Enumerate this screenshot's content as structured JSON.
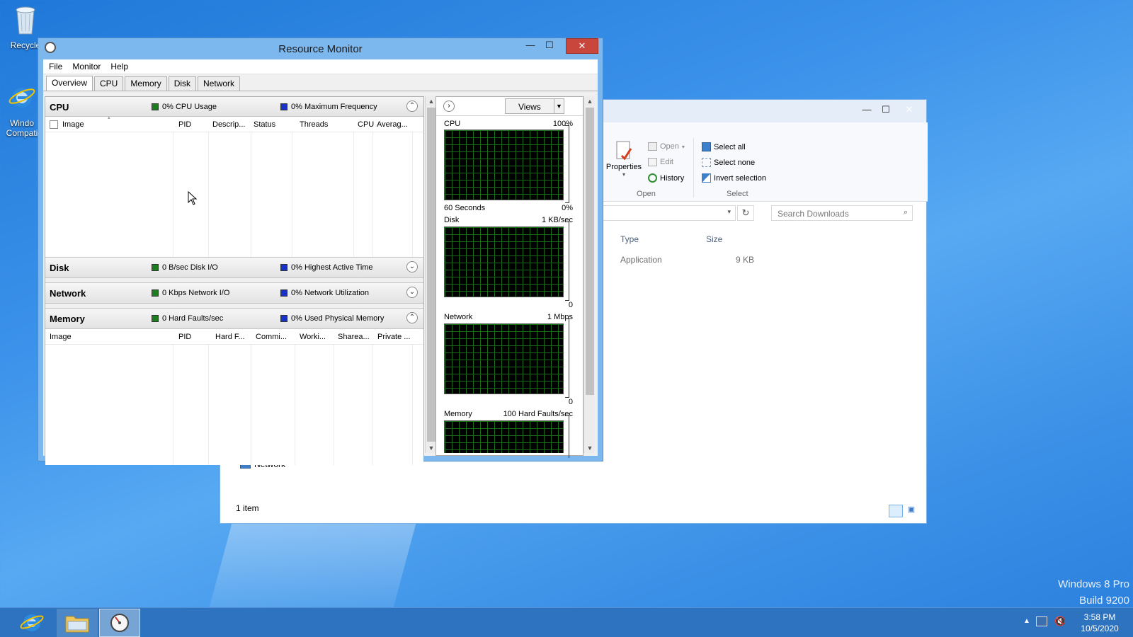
{
  "desktop": {
    "recycle_label": "Recycle",
    "ie_label_line1": "Windo",
    "ie_label_line2": "Compati",
    "watermark_line1": "Windows 8 Pro",
    "watermark_line2": "Build 9200"
  },
  "explorer": {
    "ribbon": {
      "properties": "Properties",
      "open": "Open",
      "edit": "Edit",
      "history": "History",
      "open_group": "Open",
      "select_all": "Select all",
      "select_none": "Select none",
      "invert_selection": "Invert selection",
      "select_group": "Select"
    },
    "search_placeholder": "Search Downloads",
    "columns": {
      "type": "Type",
      "size": "Size"
    },
    "row": {
      "type": "Application",
      "size": "9 KB"
    },
    "nav_network": "Network",
    "status": "1 item"
  },
  "resmon": {
    "title": "Resource Monitor",
    "menu": [
      "File",
      "Monitor",
      "Help"
    ],
    "tabs": [
      "Overview",
      "CPU",
      "Memory",
      "Disk",
      "Network"
    ],
    "active_tab": "Overview",
    "cpu": {
      "name": "CPU",
      "metric1": "0% CPU Usage",
      "metric2": "0% Maximum Frequency",
      "columns": [
        "Image",
        "PID",
        "Descrip...",
        "Status",
        "Threads",
        "CPU",
        "Averag..."
      ]
    },
    "disk": {
      "name": "Disk",
      "metric1": "0 B/sec Disk I/O",
      "metric2": "0% Highest Active Time"
    },
    "network": {
      "name": "Network",
      "metric1": "0 Kbps Network I/O",
      "metric2": "0% Network Utilization"
    },
    "memory": {
      "name": "Memory",
      "metric1": "0 Hard Faults/sec",
      "metric2": "0% Used Physical Memory",
      "columns": [
        "Image",
        "PID",
        "Hard F...",
        "Commi...",
        "Worki...",
        "Sharea...",
        "Private ..."
      ]
    },
    "views_label": "Views",
    "graphs": {
      "cpu": {
        "label": "CPU",
        "max": "100%",
        "footer_left": "60 Seconds",
        "footer_right": "0%"
      },
      "disk": {
        "label": "Disk",
        "max": "1 KB/sec",
        "footer_right": "0"
      },
      "network": {
        "label": "Network",
        "max": "1 Mbps",
        "footer_right": "0"
      },
      "memory": {
        "label": "Memory",
        "max": "100 Hard Faults/sec"
      }
    }
  },
  "taskbar": {
    "time": "3:58 PM",
    "date": "10/5/2020"
  },
  "colors": {
    "accent_green": "#1e7d1e",
    "accent_blue": "#1633c9",
    "close_red": "#c9463d"
  }
}
